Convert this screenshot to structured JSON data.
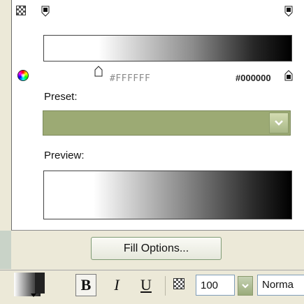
{
  "gradient_panel": {
    "left_stop_hex": "#FFFFFF",
    "right_stop_hex": "#000000",
    "preset_label": "Preset:",
    "preview_label": "Preview:",
    "fill_options_label": "Fill Options..."
  },
  "toolbar": {
    "bold_label": "B",
    "italic_label": "I",
    "underline_label": "U",
    "opacity_value": "100",
    "blend_mode": "Norma"
  },
  "colors": {
    "preset_fill": "#9caa74",
    "panel_bg": "#ffffff",
    "toolbar_bg": "#ece9d8"
  },
  "icons": [
    "opacity-checker-icon",
    "color-stop-icon",
    "color-wheel-icon",
    "chevron-down-icon"
  ]
}
